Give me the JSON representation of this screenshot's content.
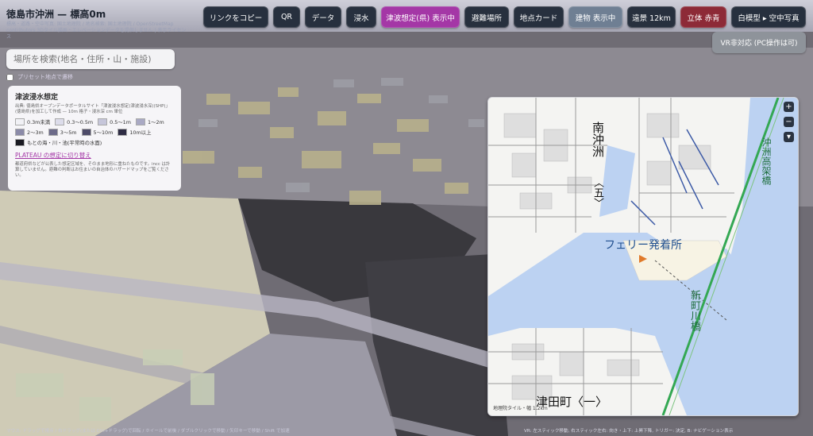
{
  "app": {
    "title": "徳島市沖洲 — 標高0m",
    "attribution": "標高・道路・空中写真: 国土地理院 / 地名検索: 国土地理院 / OpenStreetMap contributors 3Dタイル描画・エレベーションデータを提供しません | 表示ライセンス",
    "attribution_link": "表示ライセンス"
  },
  "search": {
    "placeholder": "場所を検索(地名・住所・山・施設)"
  },
  "checkbox": {
    "label": "プリセット地点で遷移"
  },
  "toolbar": {
    "buttons": [
      {
        "label": "リンクをコピー"
      },
      {
        "label": "QR"
      },
      {
        "label": "データ"
      },
      {
        "label": "浸水"
      },
      {
        "label": "津波想定(県) 表示中"
      },
      {
        "label": "避難場所"
      },
      {
        "label": "地点カード"
      },
      {
        "label": "建物 表示中"
      },
      {
        "label": "遠景 12km"
      },
      {
        "label": "立体 赤青"
      },
      {
        "label": "白模型 ▸ 空中写真"
      }
    ],
    "vr_label": "VR非対応 (PC操作は可)"
  },
  "legend": {
    "title": "津波浸水想定",
    "source": "出典: 徳島県オープンデータポータルサイト「津波浸水想定(津波浸水深)(SHP)」(徳島県)を加工して作成 — 10m 格子・浸水深 cm 単位",
    "items": [
      {
        "label": "0.3m未満",
        "color": "#f1f1f5"
      },
      {
        "label": "0.3〜0.5m",
        "color": "#dcdcea"
      },
      {
        "label": "0.5〜1m",
        "color": "#c6c6da"
      },
      {
        "label": "1〜2m",
        "color": "#a9a9c4"
      },
      {
        "label": "2〜3m",
        "color": "#8b8aa8"
      },
      {
        "label": "3〜5m",
        "color": "#6d6b8a"
      },
      {
        "label": "5〜10m",
        "color": "#4d4b68"
      },
      {
        "label": "10m以上",
        "color": "#2e2c44"
      },
      {
        "label": "もとの海・川・池(平常時の水面)",
        "color": "#1a1a22"
      }
    ],
    "link": "PLATEAU の想定に切り替え",
    "note": "都道府県などが公表した想定区域を、そのまま地形に重ねたものです。incc は計算していません。避難の判断はお住まいの自治体のハザードマップをご覧ください。"
  },
  "minimap": {
    "zoom_in": "+",
    "zoom_out": "−",
    "toggle": "▾",
    "credit": "地理院タイル・幅 1.2km",
    "labels": {
      "minami_okisu": "南沖洲",
      "go": "〈五〉",
      "ferry": "フェリー発着所",
      "okisu_bridge": "沖洲高架橋",
      "shinmachi_bridge": "新町川橋",
      "tsuda": "津田町〈一〉"
    }
  },
  "footer": {
    "left": "マウス: ドラッグで視点 / 右ドラッグ(または Ctrl+ドラッグ)で回転 / ホイールで前後 / ダブルクリックで移動 / 矢印キーで移動 / Shift で加速",
    "right": "VR: 左スティック移動, 右スティック左右: 向き・上下: 上昇下降, トリガー: 決定, B: ナビゲーション表示"
  },
  "colors": {
    "accent": "#a437a6",
    "button_dark": "#27303e",
    "button_active": "#6f7f93",
    "button_red": "#8d2a37",
    "water": "#bcd2f2",
    "rail": "#34a853"
  }
}
